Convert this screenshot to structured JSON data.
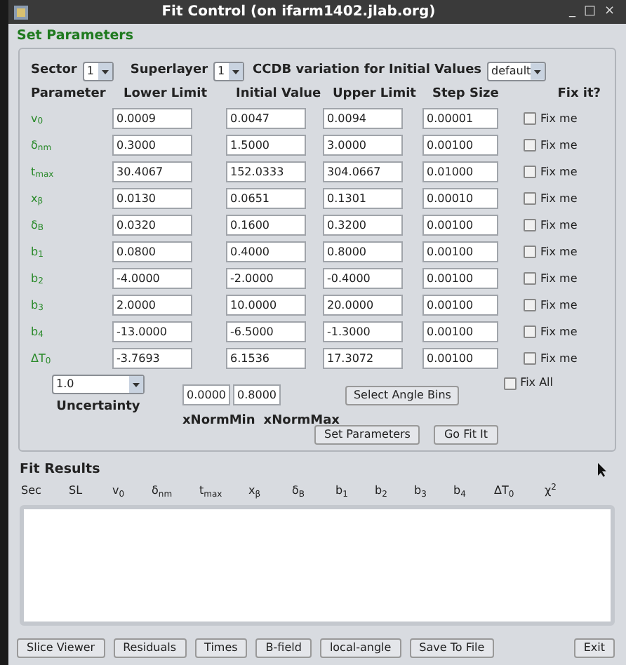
{
  "window": {
    "title": "Fit Control (on ifarm1402.jlab.org)",
    "controls": [
      "_",
      "□",
      "×"
    ]
  },
  "set_parameters": {
    "title": "Set Parameters",
    "sector": {
      "label": "Sector",
      "value": "1"
    },
    "superlayer": {
      "label": "Superlayer",
      "value": "1"
    },
    "ccdb": {
      "label": "CCDB variation for Initial Values",
      "value": "default"
    },
    "columns": [
      "Parameter",
      "Lower Limit",
      "Initial Value",
      "Upper Limit",
      "Step Size",
      "Fix it?"
    ],
    "rows": [
      {
        "name": "v$_{0}$",
        "lower": "0.0009",
        "initial": "0.0047",
        "upper": "0.0094",
        "step": "0.00001",
        "fix_label": "Fix me",
        "checked": false
      },
      {
        "name": "δ$_{nm}$",
        "lower": "0.3000",
        "initial": "1.5000",
        "upper": "3.0000",
        "step": "0.00100",
        "fix_label": "Fix me",
        "checked": false
      },
      {
        "name": "t$_{max}$",
        "lower": "30.4067",
        "initial": "152.0333",
        "upper": "304.0667",
        "step": "0.01000",
        "fix_label": "Fix me",
        "checked": false
      },
      {
        "name": "x$_{β}$",
        "lower": "0.0130",
        "initial": "0.0651",
        "upper": "0.1301",
        "step": "0.00010",
        "fix_label": "Fix me",
        "checked": false
      },
      {
        "name": "δ$_{B}$",
        "lower": "0.0320",
        "initial": "0.1600",
        "upper": "0.3200",
        "step": "0.00100",
        "fix_label": "Fix me",
        "checked": false
      },
      {
        "name": "b$_{1}$",
        "lower": "0.0800",
        "initial": "0.4000",
        "upper": "0.8000",
        "step": "0.00100",
        "fix_label": "Fix me",
        "checked": false
      },
      {
        "name": "b$_{2}$",
        "lower": "-4.0000",
        "initial": "-2.0000",
        "upper": "-0.4000",
        "step": "0.00100",
        "fix_label": "Fix me",
        "checked": false
      },
      {
        "name": "b$_{3}$",
        "lower": "2.0000",
        "initial": "10.0000",
        "upper": "20.0000",
        "step": "0.00100",
        "fix_label": "Fix me",
        "checked": false
      },
      {
        "name": "b$_{4}$",
        "lower": "-13.0000",
        "initial": "-6.5000",
        "upper": "-1.3000",
        "step": "0.00100",
        "fix_label": "Fix me",
        "checked": false
      },
      {
        "name": "ΔT$_{0}$",
        "lower": "-3.7693",
        "initial": "6.1536",
        "upper": "17.3072",
        "step": "0.00100",
        "fix_label": "Fix me",
        "checked": false
      }
    ],
    "uncertainty": {
      "value": "1.0",
      "label": "Uncertainty"
    },
    "xnorm_min": {
      "value": "0.0000",
      "label": "xNormMin"
    },
    "xnorm_max": {
      "value": "0.8000",
      "label": "xNormMax"
    },
    "fix_all": {
      "label": "Fix All",
      "checked": false
    },
    "select_angle_bins": "Select Angle Bins",
    "set_parameters_button": "Set Parameters",
    "go_fit_button": "Go Fit It"
  },
  "fit_results": {
    "title": "Fit Results",
    "columns": [
      "Sec",
      "SL",
      "v$_{0}$",
      "δ$_{nm}$",
      "t$_{max}$",
      "x$_{β}$",
      "δ$_{B}$",
      "b$_{1}$",
      "b$_{2}$",
      "b$_{3}$",
      "b$_{4}$",
      "ΔT$_{0}$",
      "χ$^{2}$"
    ]
  },
  "bottom_buttons": [
    "Slice Viewer",
    "Residuals",
    "Times",
    "B-field",
    "local-angle",
    "Save To File"
  ],
  "exit_button": "Exit"
}
